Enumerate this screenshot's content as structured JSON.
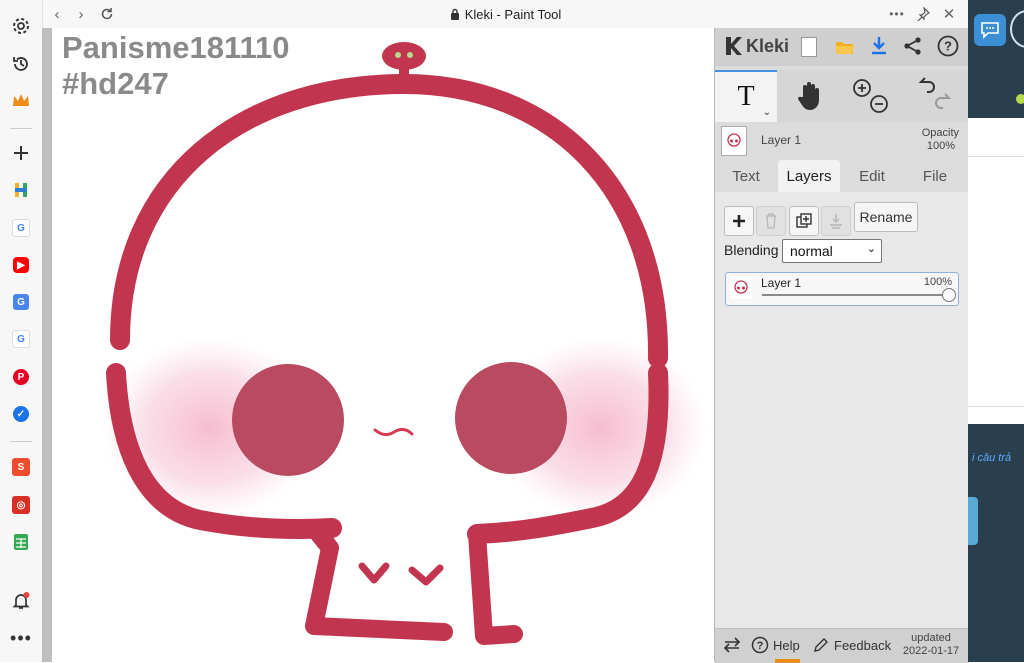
{
  "window": {
    "title": "Kleki - Paint Tool"
  },
  "canvas": {
    "watermark_line1": "Panisme181110",
    "watermark_line2": "#hd247",
    "colors": {
      "ink": "#c2354f",
      "cheek": "#b94a5f",
      "blush": "#f5c6d7",
      "mouth": "#d63a55",
      "leaf": "#b9d98a"
    }
  },
  "panel": {
    "logo_label": "Kleki",
    "current_layer": "Layer 1",
    "opacity_label": "Opacity",
    "opacity_value": "100%",
    "tabs": [
      {
        "label": "Text"
      },
      {
        "label": "Layers"
      },
      {
        "label": "Edit"
      },
      {
        "label": "File"
      }
    ],
    "layers": {
      "rename_label": "Rename",
      "blending_label": "Blending",
      "blending_value": "normal",
      "items": [
        {
          "name": "Layer 1",
          "opacity": "100%",
          "opacity_fraction": 1.0
        }
      ]
    },
    "footer": {
      "help_label": "Help",
      "feedback_label": "Feedback",
      "updated_label": "updated",
      "updated_date": "2022-01-17"
    }
  },
  "right_area": {
    "snippet": "i câu trả"
  }
}
